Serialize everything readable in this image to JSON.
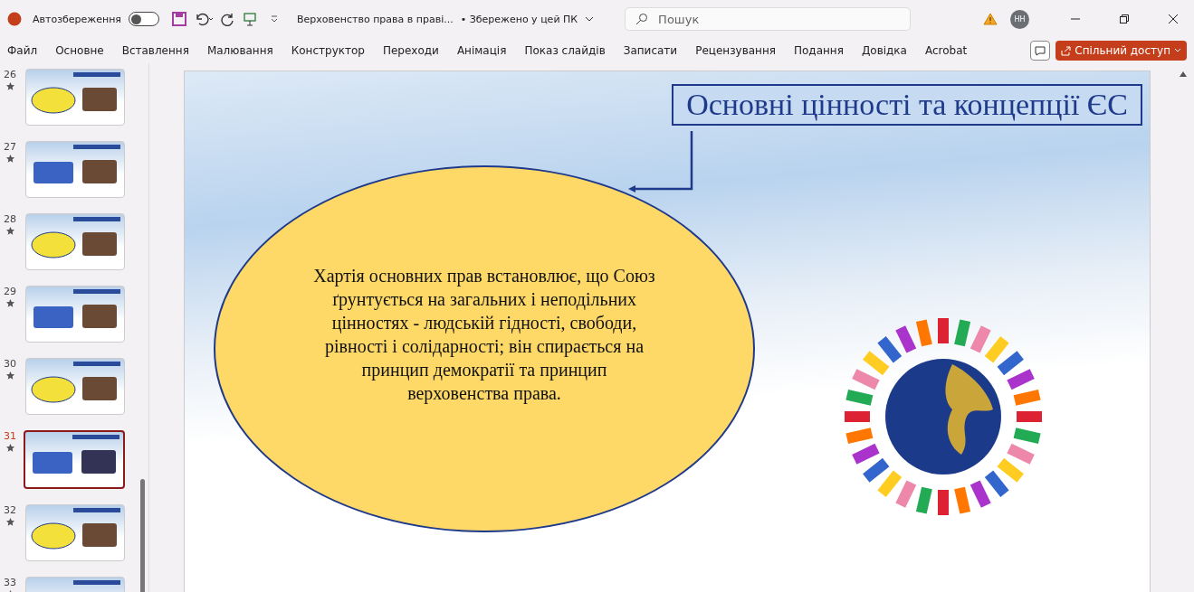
{
  "titlebar": {
    "autosave_label": "Автозбереження",
    "autosave_on": false,
    "document_title": "Верховенство права в праві...",
    "save_status": "• Збережено у цей ПК",
    "search": {
      "placeholder": "Пошук"
    },
    "user_initials": "НН"
  },
  "menu": [
    {
      "label": "Файл"
    },
    {
      "label": "Основне"
    },
    {
      "label": "Вставлення"
    },
    {
      "label": "Малювання"
    },
    {
      "label": "Конструктор"
    },
    {
      "label": "Переходи"
    },
    {
      "label": "Анімація"
    },
    {
      "label": "Показ слайдів"
    },
    {
      "label": "Записати"
    },
    {
      "label": "Рецензування"
    },
    {
      "label": "Подання"
    },
    {
      "label": "Довідка"
    },
    {
      "label": "Acrobat"
    }
  ],
  "share_button": "Спільний доступ",
  "thumbnails": [
    {
      "number": "26",
      "selected": false
    },
    {
      "number": "27",
      "selected": false
    },
    {
      "number": "28",
      "selected": false
    },
    {
      "number": "29",
      "selected": false
    },
    {
      "number": "30",
      "selected": false
    },
    {
      "number": "31",
      "selected": true
    },
    {
      "number": "32",
      "selected": false
    },
    {
      "number": "33",
      "selected": false
    }
  ],
  "slide": {
    "title": "Основні цінності та концепції ЄС",
    "body": "Хартія основних прав встановлює, що Союз ґрунтується на загальних і неподільних цінностях - людській гідності, свободи, рівності і солідарності; він спирається на принцип демократії та принцип верховенства права."
  }
}
